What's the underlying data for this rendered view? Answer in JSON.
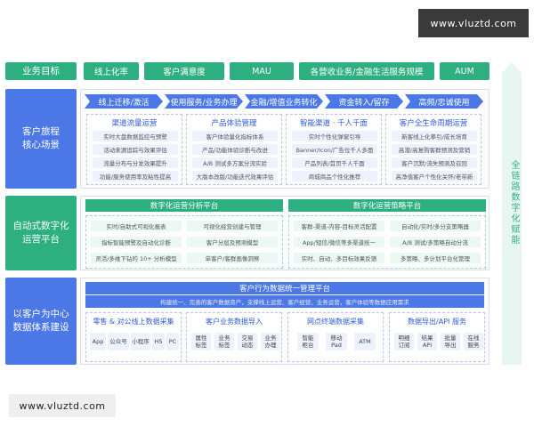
{
  "watermark": "www.vluztd.com",
  "categories": {
    "goal": "业务目标",
    "journey": "客户旅程\n核心场景",
    "ops": "自动式数字化\n运营平台",
    "data": "以客户为中心\n数据体系建设"
  },
  "goals": [
    "线上化率",
    "客户满意度",
    "MAU",
    "各营收业务/金融生活服务规模",
    "AUM"
  ],
  "journey_steps": [
    "线上迁移/激活",
    "使用服务/业务办理",
    "金融/增值业务转化",
    "资金转入/留存",
    "高频/忠诚使用"
  ],
  "journey_cards": [
    {
      "title": "渠道流量运营",
      "lines": [
        "实时大盘数据监控与预警",
        "活动来源追踪与效果评估",
        "流量分布与分发效果提升",
        "功能/服务使用率及粘性提高"
      ]
    },
    {
      "title": "产品体验管理",
      "lines": [
        "客户体验量化指标体系",
        "产品/功能体验诊断与改进",
        "A/B 测试多方案分流实验",
        "大版本改版/功能迭代效果评估"
      ]
    },
    {
      "title": "智能渠道 · 千人千面",
      "lines": [
        "实时个性化弹窗引导",
        "Banner/Icon/广告位千人多面",
        "产品列表/首页千人千面",
        "商城商品个性化推荐"
      ]
    },
    {
      "title": "客户全生命周期运营",
      "lines": [
        "新客线上化拳引/成长培育",
        "高潜/高复购客群预测及营销",
        "客户沉默/流失预测及召回",
        "高净值客户个性化关怀/老带新"
      ]
    }
  ],
  "ops": {
    "left_title": "数字化运营分析平台",
    "left_cells": [
      "实时/自助式可视化报表",
      "可视化经营创建与管理",
      "指标智能预警及自动化诊断",
      "客户分层及预测模型",
      "灵活/多维下钻的 10+ 分析模型",
      "单客户/客群画像洞察"
    ],
    "right_title": "数字化运营策略平台",
    "right_cells": [
      "客群-渠道-内容-目标灵活配置",
      "自动化/实时/多分支策略器",
      "App/短信/微信等多渠道统一",
      "A/B 测试/多策略自动分流",
      "实时、自动、多目标效果反馈",
      "多策略、多计划平台化管理"
    ]
  },
  "data": {
    "title": "客户行为数据统一管理平台",
    "subtitle": "构建统一、完善的客户数据资产，支撑线上运营、客户经营、业务运营，客户体验等数据应用需求",
    "cards": [
      {
        "title": "零售 & 对公线上数据采集",
        "chips": [
          "App",
          "公众号",
          "小程序",
          "H5",
          "PC"
        ]
      },
      {
        "title": "客户业务数据导入",
        "chips": [
          "属性\n标签",
          "业务\n标签",
          "交易\n动态",
          "业务\n办理"
        ]
      },
      {
        "title": "网点终端数据采集",
        "chips": [
          "智能\n柜台",
          "移动\nPad",
          "ATM"
        ]
      },
      {
        "title": "数据导出/API 服务",
        "chips": [
          "明细\n订阅",
          "结果\nAPI",
          "批量\n导出",
          "在线\n服务"
        ]
      }
    ]
  },
  "right_label": "全链路数字化赋能",
  "colors": {
    "green": "#2eaf80",
    "blue": "#4b78e6"
  }
}
